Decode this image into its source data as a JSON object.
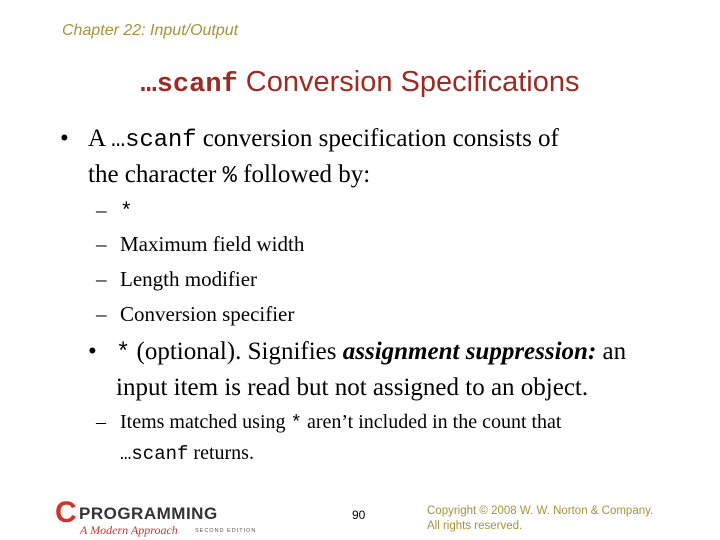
{
  "header": {
    "chapter": "Chapter 22: Input/Output"
  },
  "slide": {
    "title_code": "…scanf",
    "title_text": " Conversion Specifications",
    "bullets": [
      {
        "parts": {
          "a": "A ",
          "b_code": "…scanf",
          "c": " conversion specification consists of",
          "d": "the character ",
          "e_code": "%",
          "f": " followed by:"
        },
        "bullet_glyph": "•",
        "subitems": [
          {
            "dash": "–",
            "code": "*"
          },
          {
            "dash": "–",
            "text": "Maximum field width"
          },
          {
            "dash": "–",
            "text": "Length modifier"
          },
          {
            "dash": "–",
            "text": "Conversion specifier"
          }
        ]
      },
      {
        "bullet_glyph": "•",
        "parts": {
          "a_code": "*",
          "b": " (optional). Signifies ",
          "c_emph": "assignment suppression:",
          "d": " an",
          "e": "input item is read but not assigned to an object."
        },
        "subitems": [
          {
            "dash": "–",
            "a": "Items matched using ",
            "b_code": "*",
            "c": " aren’t included in the count that",
            "d_code": "…scanf",
            "e": " returns."
          }
        ]
      }
    ]
  },
  "footer": {
    "page_number": "90",
    "copyright_line1": "Copyright © 2008 W. W. Norton & Company.",
    "copyright_line2": "All rights reserved.",
    "logo": {
      "letter": "C",
      "word": "PROGRAMMING",
      "subtitle": "A Modern Approach",
      "edition": "SECOND EDITION"
    }
  },
  "colors": {
    "chapter": "#a8913a",
    "title": "#9c2b23",
    "body": "#000000",
    "logo_red": "#d2322b"
  }
}
